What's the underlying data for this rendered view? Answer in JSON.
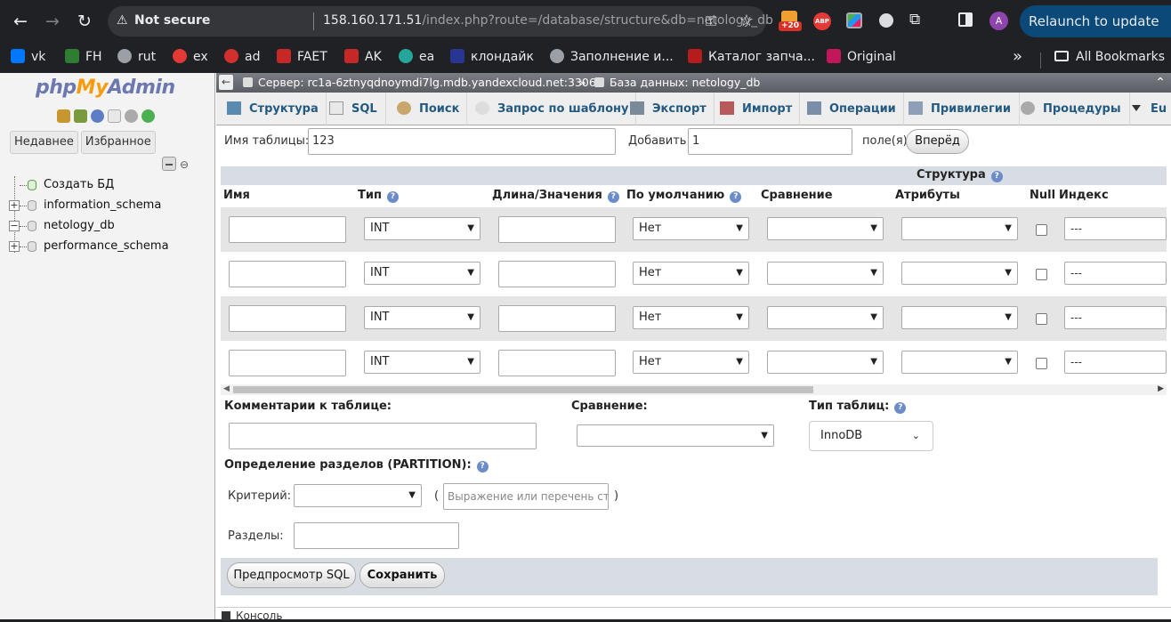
{
  "browser": {
    "not_secure": "Not secure",
    "url_host": "158.160.171.51",
    "url_rest": "/index.php?route=/database/structure&db=netology_db",
    "ext_badge": "+20",
    "abp": "ABP",
    "profile": "A",
    "relaunch": "Relaunch to update"
  },
  "bookmarks": [
    {
      "label": "vk",
      "color": "#0077ff"
    },
    {
      "label": "FH",
      "color": "#2e7d32"
    },
    {
      "label": "rut",
      "color": "#9aa0a6"
    },
    {
      "label": "ex",
      "color": "#e53935"
    },
    {
      "label": "ad",
      "color": "#d32f2f"
    },
    {
      "label": "FAET",
      "color": "#c62828"
    },
    {
      "label": "AK",
      "color": "#c62828"
    },
    {
      "label": "ea",
      "color": "#26a69a"
    },
    {
      "label": "клондайк",
      "color": "#283593"
    },
    {
      "label": "Заполнение и...",
      "color": "#9aa0a6"
    },
    {
      "label": "Каталог запча...",
      "color": "#b71c1c"
    },
    {
      "label": "Original",
      "color": "#c2185b"
    }
  ],
  "bookmarks_all": "All Bookmarks",
  "nav": {
    "logo_php": "php",
    "logo_my": "My",
    "logo_admin": "Admin",
    "tab_recent": "Недавнее",
    "tab_favorites": "Избранное",
    "tree": [
      "Создать БД",
      "information_schema",
      "netology_db",
      "performance_schema"
    ]
  },
  "breadcrumb": {
    "server": "Сервер: rc1a-6ztnyqdnoymdi7lg.mdb.yandexcloud.net:3306",
    "separator": "»",
    "database": "База данных: netology_db"
  },
  "tabs": [
    "Структура",
    "SQL",
    "Поиск",
    "Запрос по шаблону",
    "Экспорт",
    "Импорт",
    "Операции",
    "Привилегии",
    "Процедуры",
    "Eu"
  ],
  "form": {
    "table_name_label": "Имя таблицы:",
    "table_name_value": "123",
    "add_label": "Добавить",
    "add_value": "1",
    "fields_label": "поле(я)",
    "go_button": "Вперёд"
  },
  "grid": {
    "structure_header": "Структура",
    "columns": [
      "Имя",
      "Тип",
      "Длина/Значения",
      "По умолчанию",
      "Сравнение",
      "Атрибуты",
      "Null",
      "Индекс"
    ],
    "rows": [
      {
        "type": "INT",
        "default": "Нет",
        "index": "---"
      },
      {
        "type": "INT",
        "default": "Нет",
        "index": "---"
      },
      {
        "type": "INT",
        "default": "Нет",
        "index": "---"
      },
      {
        "type": "INT",
        "default": "Нет",
        "index": "---"
      }
    ]
  },
  "options": {
    "comments_label": "Комментарии к таблице:",
    "collation_label": "Сравнение:",
    "engine_label": "Тип таблиц:",
    "engine_value": "InnoDB",
    "partition_label": "Определение разделов (PARTITION):",
    "criteria_label": "Критерий:",
    "expression_placeholder": "Выражение или перечень сто",
    "partitions_label": "Разделы:",
    "open_paren": "(",
    "close_paren": ")"
  },
  "buttons": {
    "preview_sql": "Предпросмотр SQL",
    "save": "Сохранить"
  },
  "console": "Консоль"
}
